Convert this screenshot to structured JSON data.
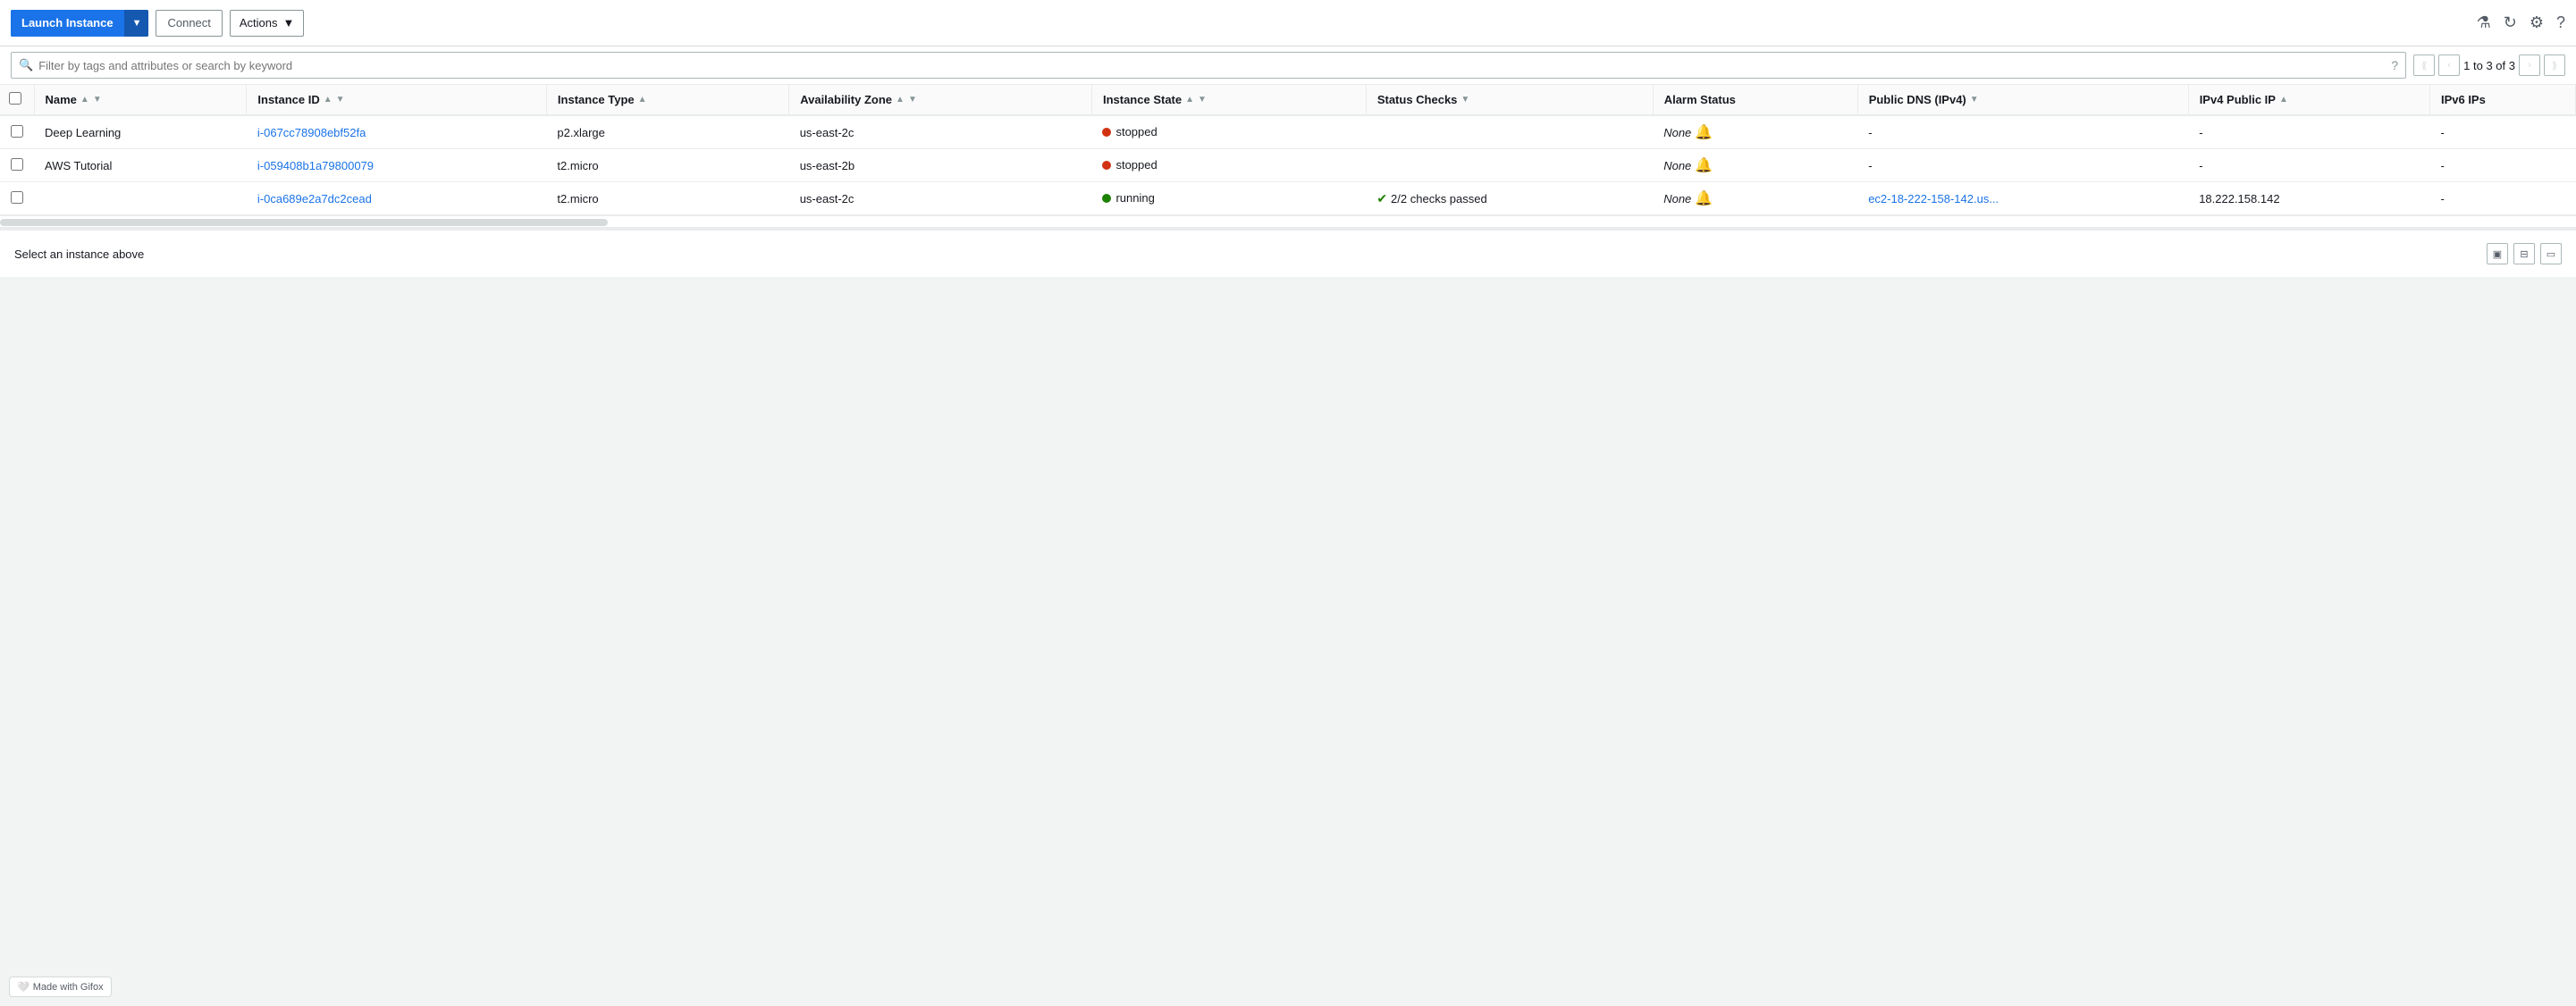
{
  "toolbar": {
    "launch_label": "Launch Instance",
    "connect_label": "Connect",
    "actions_label": "Actions",
    "icons": {
      "flask": "⚗",
      "refresh": "↻",
      "settings": "⚙",
      "help": "?"
    }
  },
  "search": {
    "placeholder": "Filter by tags and attributes or search by keyword"
  },
  "pagination": {
    "text": "1 to 3 of 3"
  },
  "table": {
    "headers": [
      {
        "id": "name",
        "label": "Name",
        "sortable": true,
        "filterable": true
      },
      {
        "id": "instance-id",
        "label": "Instance ID",
        "sortable": true,
        "filterable": true
      },
      {
        "id": "instance-type",
        "label": "Instance Type",
        "sortable": true,
        "filterable": false
      },
      {
        "id": "az",
        "label": "Availability Zone",
        "sortable": true,
        "filterable": true
      },
      {
        "id": "state",
        "label": "Instance State",
        "sortable": true,
        "filterable": true
      },
      {
        "id": "status-checks",
        "label": "Status Checks",
        "sortable": false,
        "filterable": true
      },
      {
        "id": "alarm-status",
        "label": "Alarm Status",
        "sortable": false,
        "filterable": false
      },
      {
        "id": "public-dns",
        "label": "Public DNS (IPv4)",
        "sortable": false,
        "filterable": true
      },
      {
        "id": "ipv4",
        "label": "IPv4 Public IP",
        "sortable": true,
        "filterable": false
      },
      {
        "id": "ipv6",
        "label": "IPv6 IPs",
        "sortable": false,
        "filterable": false
      }
    ],
    "rows": [
      {
        "name": "Deep Learning",
        "instance_id": "i-067cc78908ebf52fa",
        "instance_type": "p2.xlarge",
        "az": "us-east-2c",
        "state": "stopped",
        "state_color": "stopped",
        "status_checks": "",
        "alarm_status": "None",
        "public_dns": "-",
        "ipv4": "-",
        "ipv6": "-"
      },
      {
        "name": "AWS Tutorial",
        "instance_id": "i-059408b1a79800079",
        "instance_type": "t2.micro",
        "az": "us-east-2b",
        "state": "stopped",
        "state_color": "stopped",
        "status_checks": "",
        "alarm_status": "None",
        "public_dns": "-",
        "ipv4": "-",
        "ipv6": "-"
      },
      {
        "name": "",
        "instance_id": "i-0ca689e2a7dc2cead",
        "instance_type": "t2.micro",
        "az": "us-east-2c",
        "state": "running",
        "state_color": "running",
        "status_checks": "2/2 checks passed",
        "alarm_status": "None",
        "public_dns": "ec2-18-222-158-142.us...",
        "ipv4": "18.222.158.142",
        "ipv6": "-"
      }
    ]
  },
  "bottom_panel": {
    "select_text": "Select an instance above"
  },
  "gifox": {
    "label": "Made with Gifox"
  }
}
